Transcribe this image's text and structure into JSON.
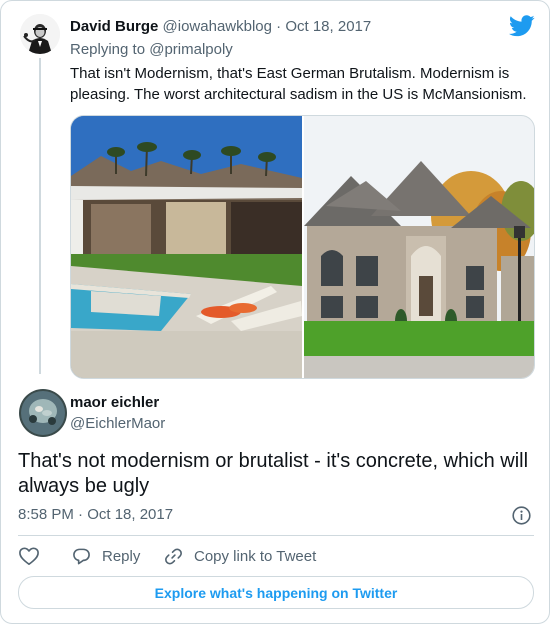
{
  "parent_tweet": {
    "name": "David Burge",
    "handle": "@iowahawkblog",
    "separator": "·",
    "date": "Oct 18, 2017",
    "replying_prefix": "Replying to ",
    "replying_to": "@primalpoly",
    "text": "That isn't Modernism, that's East German Brutalism. Modernism is pleasing. The worst architectural sadism in the US is McMansionism.",
    "media": [
      "modernist-house-photo",
      "mcmansion-photo"
    ]
  },
  "reply_tweet": {
    "name": "maor eichler",
    "handle": "@EichlerMaor",
    "text": "That's not modernism or brutalist - it's concrete, which will always be ugly",
    "timestamp": "8:58 PM · Oct 18, 2017"
  },
  "actions": {
    "like_icon": "heart-icon",
    "reply_label": "Reply",
    "reply_icon": "speech-bubble-icon",
    "copy_link_label": "Copy link to Tweet",
    "copy_link_icon": "link-icon"
  },
  "explore_button_label": "Explore what's happening on Twitter",
  "colors": {
    "accent": "#1d9bf0",
    "text_primary": "#0f1419",
    "text_secondary": "#536471",
    "border": "#cfd9de"
  }
}
